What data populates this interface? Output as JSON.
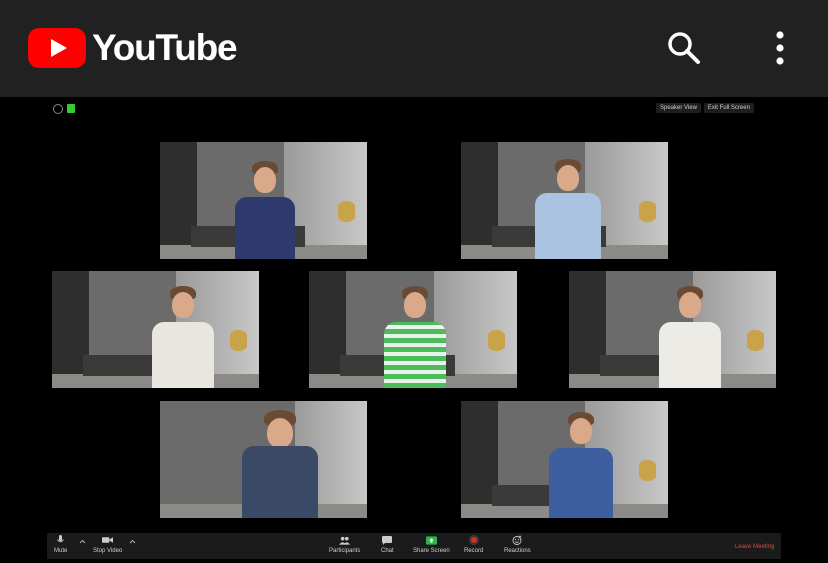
{
  "app": {
    "brand": "YouTube",
    "accent": "#ff0000",
    "header_bg": "#212121"
  },
  "header": {
    "search_icon": "search-icon",
    "menu_icon": "more-vertical-icon"
  },
  "zoom": {
    "top_right": {
      "speaker_view": "Speaker View",
      "exit_full_screen": "Exit Full Screen"
    },
    "toolbar": {
      "mute": "Mute",
      "stop_video": "Stop Video",
      "participants": "Participants",
      "chat": "Chat",
      "share_screen": "Share Screen",
      "record": "Record",
      "reactions": "Reactions",
      "leave": "Leave Meeting"
    },
    "colors": {
      "share_green": "#2fb64a",
      "record_red": "#e02b22",
      "leave_red": "#e0483e"
    }
  }
}
